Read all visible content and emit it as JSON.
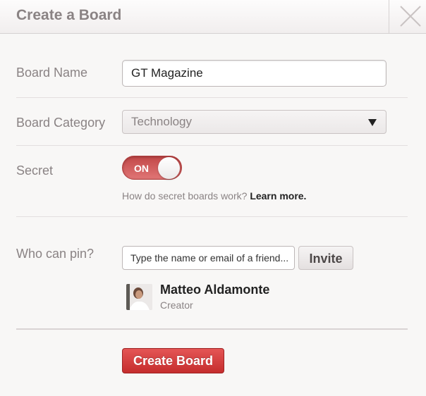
{
  "dialog": {
    "title": "Create a Board",
    "close_icon": "close-icon"
  },
  "form": {
    "board_name_label": "Board Name",
    "board_name_value": "GT Magazine",
    "board_category_label": "Board Category",
    "board_category_value": "Technology",
    "secret_label": "Secret",
    "secret_toggle_text": "ON",
    "secret_state": true,
    "secret_help_text": "How do secret boards work?",
    "secret_help_link": "Learn more.",
    "who_can_pin_label": "Who can pin?",
    "pin_input_placeholder": "Type the name or email of a friend...",
    "invite_label": "Invite",
    "create_label": "Create Board"
  },
  "collaborator": {
    "name": "Matteo Aldamonte",
    "role": "Creator"
  },
  "colors": {
    "accent": "#cb2027",
    "label_grey": "#8a8384",
    "background": "#f8f7f6"
  }
}
